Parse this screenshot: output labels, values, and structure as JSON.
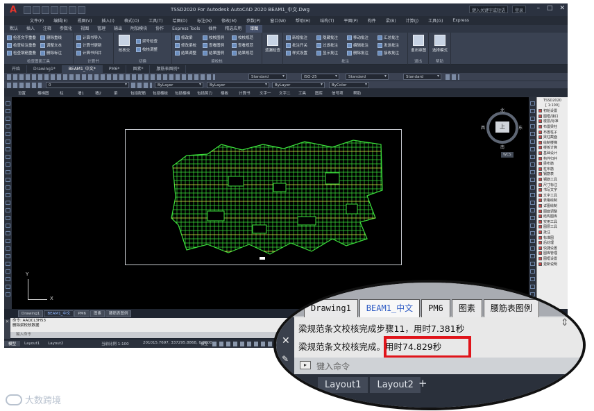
{
  "app": {
    "logo": "A",
    "title": "TSSD2020 For Autodesk AutoCAD 2020    BEAM1_中文.Dwg",
    "search_placeholder": "键入关键字或短语",
    "user_label": "登录"
  },
  "menu": [
    "文件(F)",
    "编辑(E)",
    "视图(V)",
    "插入(I)",
    "格式(O)",
    "工具(T)",
    "绘图(D)",
    "标注(N)",
    "修改(M)",
    "参数(P)",
    "窗口(W)",
    "帮助(H)",
    "结构(T)",
    "平面(P)",
    "构件",
    "梁(B)",
    "计算(J)",
    "工具(G)",
    "Express"
  ],
  "ribbon_tabs": [
    "默认",
    "插入",
    "注释",
    "参数化",
    "视图",
    "管理",
    "输出",
    "附加模块",
    "协作",
    "Express Tools",
    "插件",
    "精选应用",
    "审图"
  ],
  "ribbon_active_tab": "审图",
  "ribbon": {
    "group1": {
      "title": "检查图面工具",
      "cmds": [
        "检查文字重叠",
        "删除重线",
        "检查标注重叠",
        "调整文本",
        "检查钢筋重叠",
        "删除标注"
      ]
    },
    "group2": {
      "title": "计算书",
      "cmds": [
        "计算书导入",
        "计算书更新",
        "计算书归并"
      ]
    },
    "group3": {
      "title": "切换",
      "cmds": [
        "校核交",
        "梁号检查",
        "校核调整"
      ]
    },
    "group4": {
      "title": "梁校核",
      "cmds": [
        "修改梁",
        "修改梁校",
        "结果调整",
        "校核图例",
        "查看图例",
        "结果图例",
        "校核规范",
        "查看规范",
        "结果规范"
      ]
    },
    "group5": {
      "title": "梁校核",
      "big": "遗漏检查"
    },
    "group6": {
      "title": "批注",
      "cmds": [
        "新增批注",
        "批注开关",
        "样式设置",
        "隐藏批注",
        "过滤批注",
        "显示批注",
        "移动批注",
        "编辑批注",
        "删除批注",
        "汇总批注",
        "发送批注",
        "接收批注"
      ]
    },
    "group7": {
      "title": "退出",
      "big": "退出审图"
    },
    "group8": {
      "title": "帮助",
      "big": "选择模式"
    }
  },
  "file_tabs": [
    "开始",
    "Drawing1*",
    "BEAM1_中文*",
    "PM6*",
    "图素*",
    "腰筋表图例*"
  ],
  "file_tab_active": "BEAM1_中文*",
  "toolbars": {
    "text_style": "Standard",
    "dim_style": "ISO-25",
    "table_style": "Standard",
    "mleader_style": "Standard",
    "layer": "0",
    "color": "ByLayer",
    "linetype": "ByLayer",
    "lineweight": "ByLayer",
    "plotstyle": "ByColor"
  },
  "tssd_menu": [
    "设置",
    "楼梯图",
    "柱",
    "墙1",
    "墙2",
    "梁",
    "包括配筋",
    "包括楼板",
    "包括楼梯",
    "包括剪力",
    "楼板",
    "计算书",
    "文字一",
    "文字二",
    "工具",
    "图库",
    "信号项",
    "帮助"
  ],
  "viewcube": {
    "north": "北",
    "south": "南",
    "east": "东",
    "west": "西",
    "face": "上",
    "wcs": "WCS"
  },
  "ucs": {
    "x": "X",
    "y": "Y"
  },
  "tssd_panel": {
    "title": "TSSD2020\n[ 1:100]",
    "items": [
      "初始设置",
      "图框/接口",
      "楼层/标准",
      "布置梁柱",
      "布置柱子",
      "梁柱截面",
      "绘制楼梯",
      "楼板计算",
      "基础设计",
      "构件归并",
      "梁布筋",
      "柱布筋",
      "钢筋表",
      "钢筋工具",
      "尺寸标注",
      "书写文字",
      "文字工具",
      "表格绘制",
      "详图绘制",
      "图面调整",
      "结构图库",
      "实用工具",
      "图层工具",
      "批注",
      "标准图",
      "后处理",
      "快捷设置",
      "图库管理",
      "图框设置",
      "更新说明"
    ]
  },
  "layout_tabs": [
    "Drawing1",
    "BEAM1_中文",
    "PM6",
    "图素",
    "腰筋表图例"
  ],
  "layout_tab_active": "BEAM1_中文",
  "command": {
    "history": [
      "命令: AAQCL3H53",
      "删除梁校核数据"
    ],
    "prompt": "键入命令"
  },
  "status": {
    "tabs": [
      "模型",
      "Layout1",
      "Layout2"
    ],
    "active": "模型",
    "scale": "当前比例 1:100",
    "coords": "201015.7697, 337295.8868, 0.0000",
    "model": "模型"
  },
  "callout": {
    "tabs": [
      "Drawing1",
      "BEAM1_中文",
      "PM6",
      "图素",
      "腰筋表图例"
    ],
    "active_tab": "BEAM1_中文",
    "line1": "梁规范条文校核完成步骤11，用时7.381秒",
    "line2_prefix": "梁规范条文校核完成。",
    "line2_time": "用时74.829秒",
    "prompt": "键入命令",
    "layouts": [
      "Layout1",
      "Layout2"
    ],
    "plus": "+"
  },
  "watermark": "大数跨境",
  "colors": {
    "highlight": "#e0141a",
    "active_tab_text": "#2b59c3",
    "plan_green": "#3be03b",
    "plan_yellow": "#e8e84a"
  }
}
